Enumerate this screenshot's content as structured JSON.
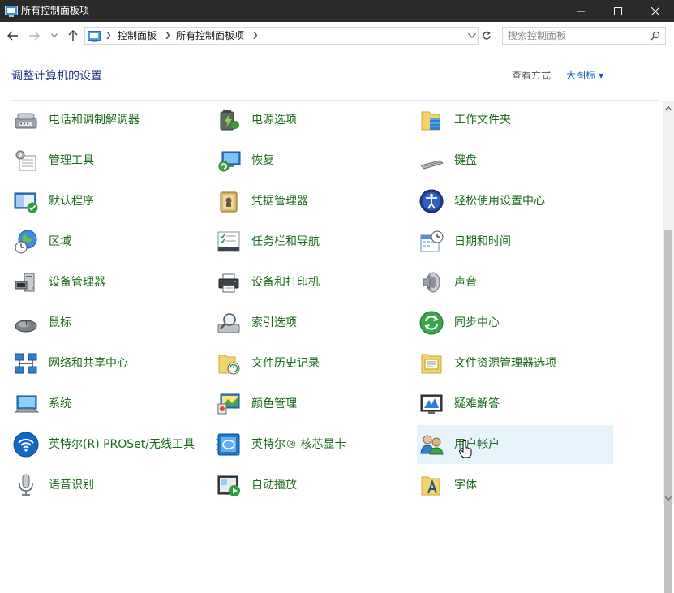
{
  "window": {
    "title": "所有控制面板项"
  },
  "address": {
    "crumbs": [
      "控制面板",
      "所有控制面板项"
    ]
  },
  "search": {
    "placeholder": "搜索控制面板"
  },
  "header": {
    "title": "调整计算机的设置",
    "viewby_label": "查看方式",
    "viewby_value": "大图标"
  },
  "colors": {
    "titlebar_bg": "#2b2b2b",
    "link_green": "#1a6a1a",
    "title_blue": "#1e3287",
    "accent_blue": "#0b61c4",
    "hover_bg": "#e5f3fb"
  },
  "items": [
    {
      "label": "电话和调制解调器",
      "icon": "phone-modem-icon"
    },
    {
      "label": "电源选项",
      "icon": "power-options-icon"
    },
    {
      "label": "工作文件夹",
      "icon": "work-folders-icon"
    },
    {
      "label": "管理工具",
      "icon": "admin-tools-icon"
    },
    {
      "label": "恢复",
      "icon": "recovery-icon"
    },
    {
      "label": "键盘",
      "icon": "keyboard-icon"
    },
    {
      "label": "默认程序",
      "icon": "default-programs-icon"
    },
    {
      "label": "凭据管理器",
      "icon": "credential-manager-icon"
    },
    {
      "label": "轻松使用设置中心",
      "icon": "ease-of-access-icon"
    },
    {
      "label": "区域",
      "icon": "region-icon"
    },
    {
      "label": "任务栏和导航",
      "icon": "taskbar-navigation-icon"
    },
    {
      "label": "日期和时间",
      "icon": "date-time-icon"
    },
    {
      "label": "设备管理器",
      "icon": "device-manager-icon"
    },
    {
      "label": "设备和打印机",
      "icon": "devices-printers-icon"
    },
    {
      "label": "声音",
      "icon": "sound-icon"
    },
    {
      "label": "鼠标",
      "icon": "mouse-icon"
    },
    {
      "label": "索引选项",
      "icon": "indexing-options-icon"
    },
    {
      "label": "同步中心",
      "icon": "sync-center-icon"
    },
    {
      "label": "网络和共享中心",
      "icon": "network-sharing-icon"
    },
    {
      "label": "文件历史记录",
      "icon": "file-history-icon"
    },
    {
      "label": "文件资源管理器选项",
      "icon": "explorer-options-icon"
    },
    {
      "label": "系统",
      "icon": "system-icon"
    },
    {
      "label": "颜色管理",
      "icon": "color-management-icon"
    },
    {
      "label": "疑难解答",
      "icon": "troubleshooting-icon"
    },
    {
      "label": "英特尔(R) PROSet/无线工具",
      "icon": "intel-wireless-icon"
    },
    {
      "label": "英特尔® 核芯显卡",
      "icon": "intel-graphics-icon"
    },
    {
      "label": "用户帐户",
      "icon": "user-accounts-icon"
    },
    {
      "label": "语音识别",
      "icon": "speech-recognition-icon"
    },
    {
      "label": "自动播放",
      "icon": "autoplay-icon"
    },
    {
      "label": "字体",
      "icon": "fonts-icon"
    }
  ]
}
